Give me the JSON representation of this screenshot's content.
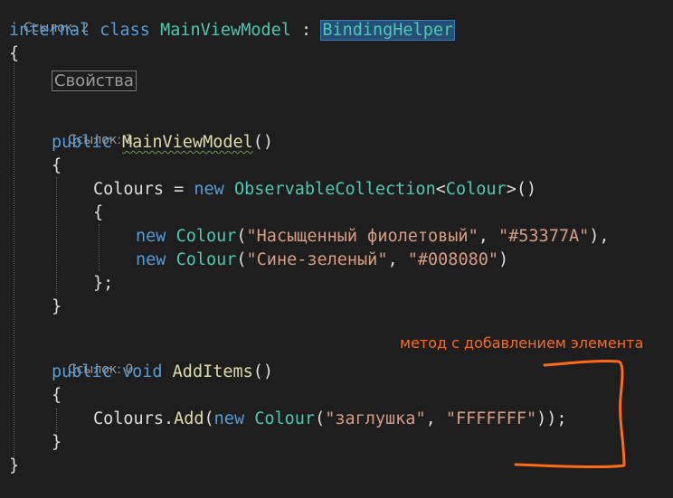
{
  "code_lens": {
    "class_refs": "Ссылок: 2",
    "ctor_refs": "Ссылок: 1",
    "method_refs": "Ссылок: 0"
  },
  "code": {
    "kw_internal": "internal",
    "kw_class": "class",
    "class_name": "MainViewModel",
    "colon": " : ",
    "base_class": "BindingHelper",
    "region_label": "Свойства",
    "kw_public": "public",
    "ctor_name": "MainViewModel",
    "parens": "()",
    "prop_colours": "Colours",
    "assign": " = ",
    "kw_new": "new",
    "collection_type": "ObservableCollection",
    "generic_open": "<",
    "colour_type": "Colour",
    "generic_close": ">()",
    "open_brace": "{",
    "close_brace": "}",
    "close_brace_semi": "};",
    "paren_open": "(",
    "str_purple_name": "\"Насыщенный фиолетовый\"",
    "str_purple_hex": "\"#53377A\"",
    "str_teal_name": "\"Сине-зеленый\"",
    "str_teal_hex": "\"#008080\"",
    "comma_space": ", ",
    "close_paren_comma": "),",
    "close_paren": ")",
    "kw_void": "void",
    "method_name": "AddItems",
    "dot": ".",
    "add_method": "Add",
    "str_stub_name": "\"заглушка\"",
    "str_stub_hex": "\"FFFFFFF\"",
    "close_call": "));"
  },
  "annotation": {
    "text": "метод с добавлением элемента",
    "color": "#ff6a1a"
  }
}
